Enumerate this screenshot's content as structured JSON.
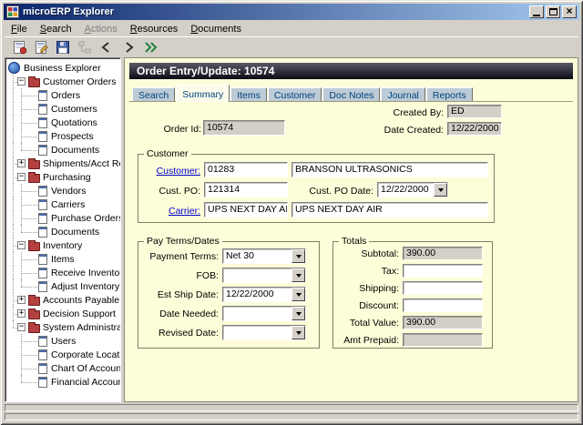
{
  "window": {
    "title": "microERP Explorer",
    "controls": [
      {
        "name": "minimize-button"
      },
      {
        "name": "maximize-button"
      },
      {
        "name": "close-button"
      }
    ]
  },
  "menu": {
    "items": [
      {
        "label": "File",
        "enabled": true
      },
      {
        "label": "Search",
        "enabled": true
      },
      {
        "label": "Actions",
        "enabled": false
      },
      {
        "label": "Resources",
        "enabled": true
      },
      {
        "label": "Documents",
        "enabled": true
      }
    ]
  },
  "toolbar": {
    "buttons": [
      {
        "name": "new-record-icon",
        "enabled": true
      },
      {
        "name": "edit-record-icon",
        "enabled": true
      },
      {
        "name": "save-icon",
        "enabled": true
      },
      {
        "name": "network-icon",
        "enabled": false
      },
      {
        "name": "back-icon",
        "enabled": true
      },
      {
        "name": "forward-icon",
        "enabled": true
      },
      {
        "name": "forward-double-icon",
        "enabled": true
      }
    ]
  },
  "tree": {
    "root": "Business Explorer",
    "nodes": [
      {
        "label": "Customer Orders",
        "expanded": true,
        "children": [
          "Orders",
          "Customers",
          "Quotations",
          "Prospects",
          "Documents"
        ]
      },
      {
        "label": "Shipments/Acct Receiv",
        "expanded": false,
        "children": []
      },
      {
        "label": "Purchasing",
        "expanded": true,
        "children": [
          "Vendors",
          "Carriers",
          "Purchase Orders",
          "Documents"
        ]
      },
      {
        "label": "Inventory",
        "expanded": true,
        "children": [
          "Items",
          "Receive Inventory",
          "Adjust Inventory"
        ]
      },
      {
        "label": "Accounts Payable",
        "expanded": false,
        "children": []
      },
      {
        "label": "Decision Support",
        "expanded": false,
        "children": []
      },
      {
        "label": "System Administration",
        "expanded": true,
        "children": [
          "Users",
          "Corporate Location",
          "Chart Of Accounts",
          "Financial Account"
        ]
      }
    ]
  },
  "main": {
    "header": "Order Entry/Update: 10574",
    "active_tab": "Summary",
    "tabs": [
      "Search",
      "Summary",
      "Items",
      "Customer",
      "Doc Notes",
      "Journal",
      "Reports"
    ],
    "fields": {
      "order_id_label": "Order Id:",
      "order_id": "10574",
      "created_by_label": "Created By:",
      "created_by": "ED",
      "date_created_label": "Date Created:",
      "date_created": "12/22/2000"
    },
    "customer_group": {
      "title": "Customer",
      "customer_label": "Customer:",
      "customer_code": "01283",
      "customer_name": "BRANSON ULTRASONICS",
      "cust_po_label": "Cust. PO:",
      "cust_po": "121314",
      "cust_po_date_label": "Cust. PO Date:",
      "cust_po_date": "12/22/2000",
      "carrier_label": "Carrier:",
      "carrier_code": "UPS NEXT DAY AIR",
      "carrier_name": "UPS NEXT DAY AIR"
    },
    "payterms_group": {
      "title": "Pay Terms/Dates",
      "rows": [
        {
          "label": "Payment Terms:",
          "value": "Net 30"
        },
        {
          "label": "FOB:",
          "value": ""
        },
        {
          "label": "Est Ship Date:",
          "value": "12/22/2000"
        },
        {
          "label": "Date Needed:",
          "value": ""
        },
        {
          "label": "Revised Date:",
          "value": ""
        }
      ]
    },
    "totals_group": {
      "title": "Totals",
      "rows": [
        {
          "label": "Subtotal:",
          "value": "390.00",
          "readonly": true
        },
        {
          "label": "Tax:",
          "value": "",
          "readonly": false
        },
        {
          "label": "Shipping:",
          "value": "",
          "readonly": false
        },
        {
          "label": "Discount:",
          "value": "",
          "readonly": false
        },
        {
          "label": "Total Value:",
          "value": "390.00",
          "readonly": true
        },
        {
          "label": "Amt Prepaid:",
          "value": "",
          "readonly": true
        }
      ]
    }
  },
  "colors": {
    "titlebar_start": "#0a246a",
    "titlebar_end": "#a6caf0",
    "chrome": "#d4d0c8",
    "panel_cream": "#fdfdd9",
    "header_dark": "#0c0c16",
    "link_blue": "#0000cc",
    "tab_inactive": "#bccbd6",
    "tab_text": "#00427e",
    "readonly_gray": "#d4d0c8"
  }
}
